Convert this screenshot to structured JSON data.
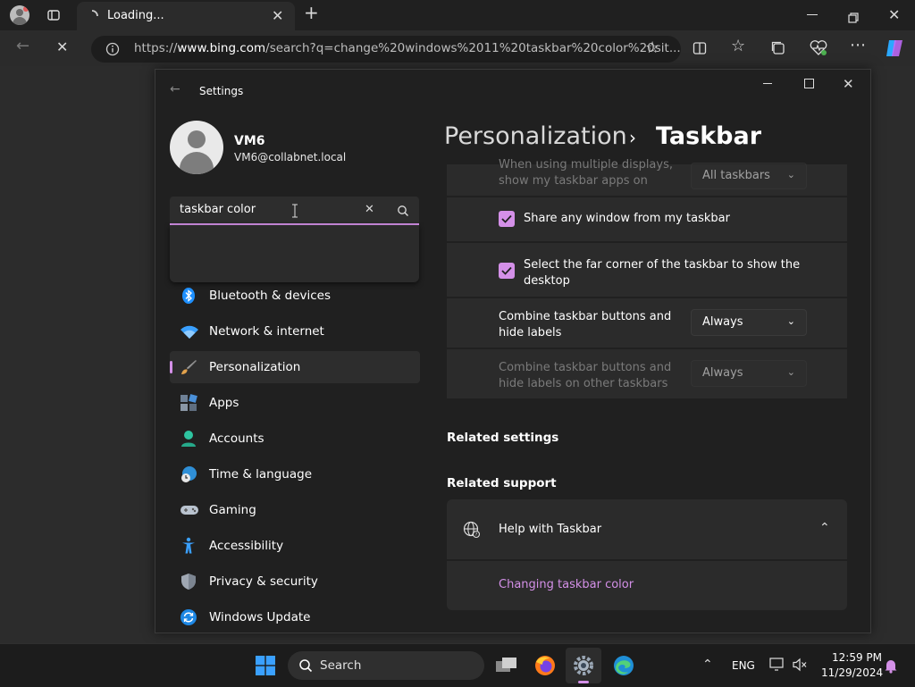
{
  "browser": {
    "tab_title": "Loading...",
    "url_prefix": "https://",
    "url_domain": "www.bing.com",
    "url_rest": "/search?q=change%20windows%2011%20taskbar%20color%20sit..."
  },
  "settings": {
    "window_title": "Settings",
    "user_name": "VM6",
    "user_email": "VM6@collabnet.local",
    "search_value": "taskbar color",
    "nav": [
      {
        "label": "Bluetooth & devices",
        "icon": "bluetooth-icon"
      },
      {
        "label": "Network & internet",
        "icon": "wifi-icon"
      },
      {
        "label": "Personalization",
        "icon": "brush-icon",
        "selected": true
      },
      {
        "label": "Apps",
        "icon": "apps-icon"
      },
      {
        "label": "Accounts",
        "icon": "account-icon"
      },
      {
        "label": "Time & language",
        "icon": "globe-clock-icon"
      },
      {
        "label": "Gaming",
        "icon": "gamepad-icon"
      },
      {
        "label": "Accessibility",
        "icon": "accessibility-icon"
      },
      {
        "label": "Privacy & security",
        "icon": "shield-icon"
      },
      {
        "label": "Windows Update",
        "icon": "update-icon"
      }
    ],
    "breadcrumb_parent": "Personalization",
    "breadcrumb_sep": "›",
    "breadcrumb_current": "Taskbar",
    "rows": {
      "multi_display_line1": "When using multiple displays,",
      "multi_display_line2": "show my taskbar apps on",
      "multi_display_value": "All taskbars",
      "share_window": "Share any window from my taskbar",
      "far_corner_line1": "Select the far corner of the taskbar to show the",
      "far_corner_line2": "desktop",
      "combine_line1": "Combine taskbar buttons and",
      "combine_line2": "hide labels",
      "combine_value": "Always",
      "combine_other_line1": "Combine taskbar buttons and",
      "combine_other_line2": "hide labels on other taskbars",
      "combine_other_value": "Always"
    },
    "related_settings": "Related settings",
    "related_support": "Related support",
    "help_title": "Help with Taskbar",
    "help_link": "Changing taskbar color"
  },
  "taskbar": {
    "search_label": "Search",
    "lang": "ENG",
    "time": "12:59 PM",
    "date": "11/29/2024"
  },
  "colors": {
    "accent": "#d490e8",
    "bing_blue": "#1e90ff"
  }
}
